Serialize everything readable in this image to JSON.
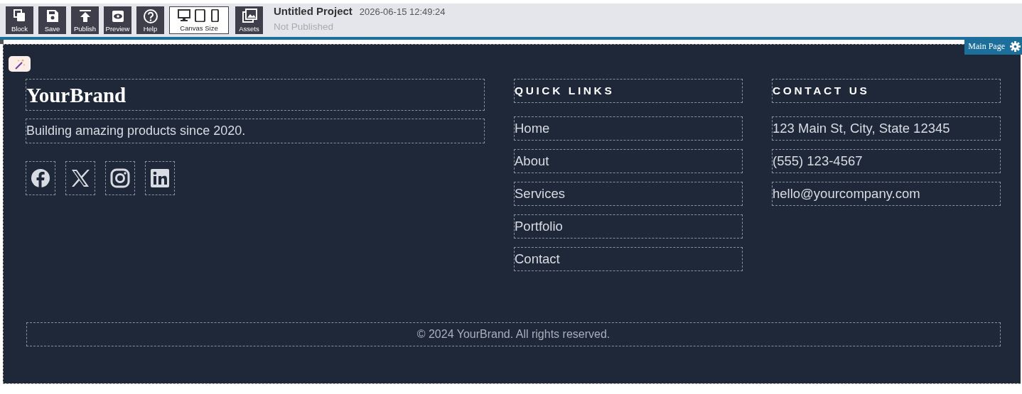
{
  "toolbar": {
    "buttons": [
      {
        "label": "Block",
        "kind": "block"
      },
      {
        "label": "Save",
        "kind": "save"
      },
      {
        "label": "Publish",
        "kind": "publish"
      },
      {
        "label": "Preview",
        "kind": "preview"
      },
      {
        "label": "Help",
        "kind": "help"
      }
    ],
    "canvas_size": {
      "label": "Canvas Size"
    },
    "assets": {
      "label": "Assets"
    },
    "project": {
      "title": "Untitled Project",
      "timestamp": "2026-06-15 12:49:24",
      "status": "Not Published"
    }
  },
  "page_tab": {
    "label": "Main Page"
  },
  "footer": {
    "brand": "YourBrand",
    "tagline": "Building amazing products since 2020.",
    "social": [
      {
        "kind": "facebook"
      },
      {
        "kind": "x"
      },
      {
        "kind": "instagram"
      },
      {
        "kind": "linkedin"
      }
    ],
    "quick_links": {
      "heading": "QUICK LINKS",
      "items": [
        "Home",
        "About",
        "Services",
        "Portfolio",
        "Contact"
      ]
    },
    "contact": {
      "heading": "CONTACT US",
      "items": [
        "123 Main St, City, State 12345",
        "(555) 123-4567",
        "hello@yourcompany.com"
      ]
    },
    "copyright": "© 2024 YourBrand. All rights reserved."
  }
}
